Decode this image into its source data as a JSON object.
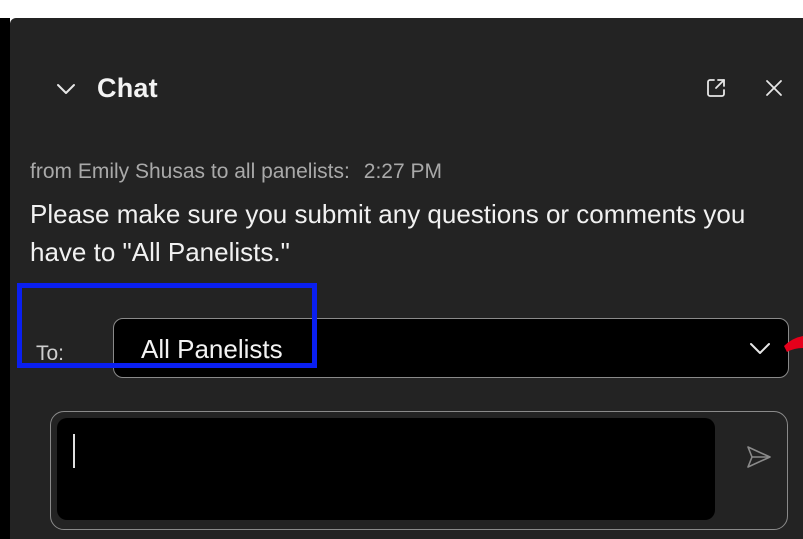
{
  "header": {
    "title": "Chat",
    "icons": [
      "chevron-down-icon",
      "popout-icon",
      "close-icon"
    ]
  },
  "message": {
    "sender_line": "from Emily Shusas to all panelists:",
    "time": "2:27 PM",
    "text": "Please make sure you submit any questions or comments you have to \"All Panelists.\""
  },
  "recipient": {
    "label": "To:",
    "selected": "All Panelists"
  },
  "compose": {
    "value": "",
    "send_icon": "send-icon"
  },
  "colors": {
    "panel_bg": "#232323",
    "input_bg": "#000000",
    "highlight": "#0a1ff0",
    "pointer": "#e5001b",
    "text_primary": "#f1f1f1",
    "text_meta": "#a9a9a9"
  }
}
